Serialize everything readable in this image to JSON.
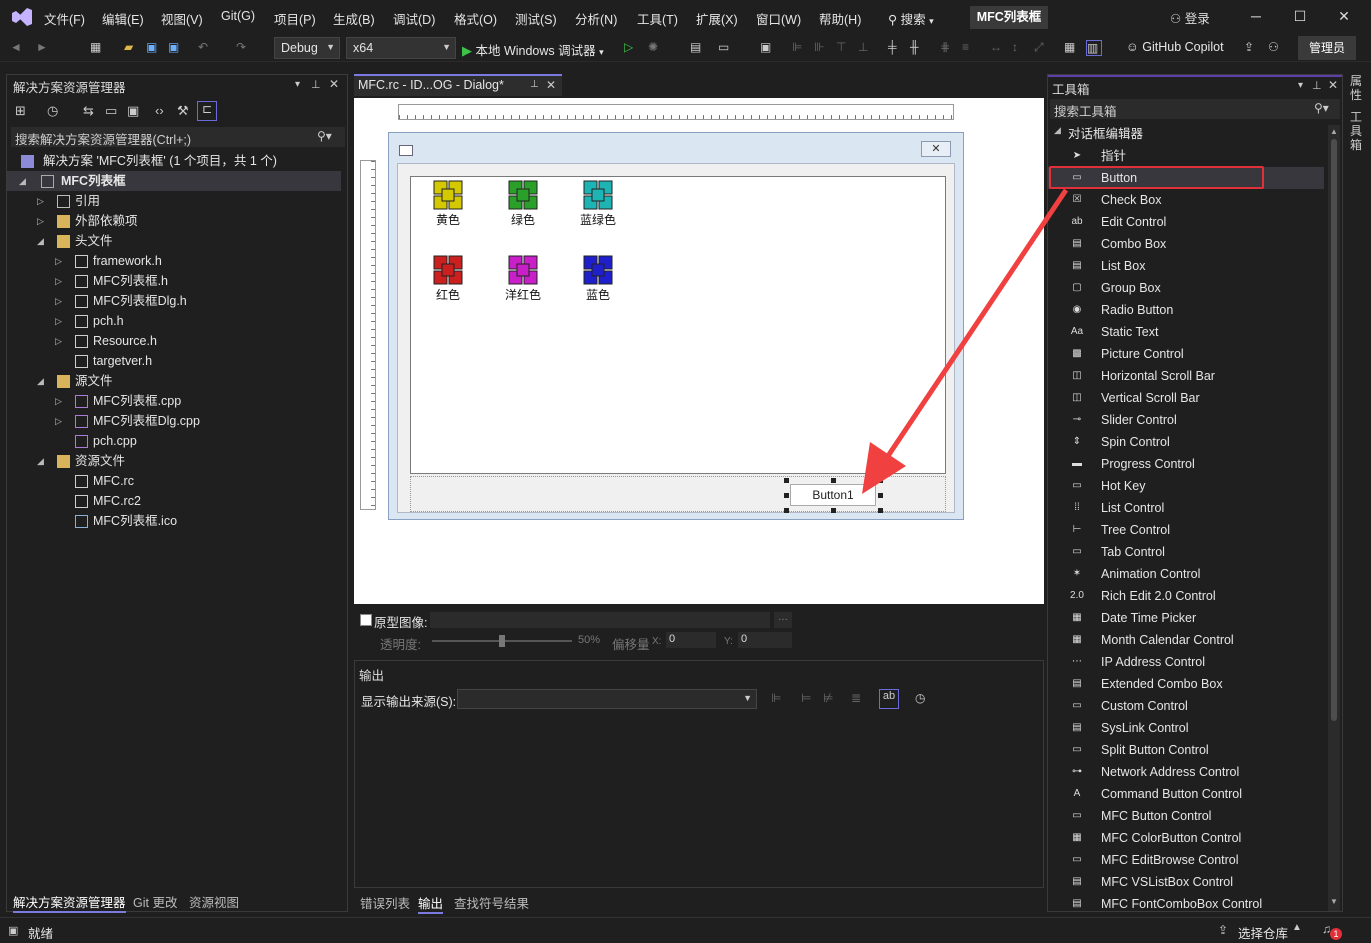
{
  "menubar": {
    "items": [
      "文件(F)",
      "编辑(E)",
      "视图(V)",
      "Git(G)",
      "项目(P)",
      "生成(B)",
      "调试(D)",
      "格式(O)",
      "测试(S)",
      "分析(N)",
      "工具(T)",
      "扩展(X)",
      "窗口(W)",
      "帮助(H)"
    ],
    "search_label": "搜索",
    "project_name": "MFC列表框",
    "login_label": "登录"
  },
  "toolbar": {
    "config": "Debug",
    "platform": "x64",
    "run_label": "本地 Windows 调试器",
    "copilot_label": "GitHub Copilot",
    "admin_label": "管理员"
  },
  "solution_explorer": {
    "title": "解决方案资源管理器",
    "search_placeholder": "搜索解决方案资源管理器(Ctrl+;)",
    "solution_label": "解决方案 'MFC列表框' (1 个项目，共 1 个)",
    "project": "MFC列表框",
    "nodes": [
      {
        "label": "引用",
        "kind": "ref"
      },
      {
        "label": "外部依赖项",
        "kind": "folder"
      },
      {
        "label": "头文件",
        "kind": "folder"
      },
      {
        "label": "framework.h",
        "kind": "h"
      },
      {
        "label": "MFC列表框.h",
        "kind": "h"
      },
      {
        "label": "MFC列表框Dlg.h",
        "kind": "h"
      },
      {
        "label": "pch.h",
        "kind": "h"
      },
      {
        "label": "Resource.h",
        "kind": "h"
      },
      {
        "label": "targetver.h",
        "kind": "h"
      },
      {
        "label": "源文件",
        "kind": "folder"
      },
      {
        "label": "MFC列表框.cpp",
        "kind": "cpp"
      },
      {
        "label": "MFC列表框Dlg.cpp",
        "kind": "cpp"
      },
      {
        "label": "pch.cpp",
        "kind": "cpp"
      },
      {
        "label": "资源文件",
        "kind": "folder"
      },
      {
        "label": "MFC.rc",
        "kind": "rc"
      },
      {
        "label": "MFC.rc2",
        "kind": "rc"
      },
      {
        "label": "MFC列表框.ico",
        "kind": "ico"
      }
    ],
    "bottom_tabs": [
      "解决方案资源管理器",
      "Git 更改",
      "资源视图"
    ]
  },
  "editor": {
    "tab_label": "MFC.rc - ID...OG - Dialog*",
    "list_items": [
      {
        "label": "黄色",
        "color": "#d4c800"
      },
      {
        "label": "绿色",
        "color": "#2aa02a"
      },
      {
        "label": "蓝绿色",
        "color": "#1fb4b4"
      },
      {
        "label": "红色",
        "color": "#cc1f1f"
      },
      {
        "label": "洋红色",
        "color": "#c81fc8"
      },
      {
        "label": "蓝色",
        "color": "#1f1fcc"
      }
    ],
    "button_label": "Button1",
    "proto_label": "原型图像:",
    "opacity_label": "透明度:",
    "opacity_value": "50%",
    "offset_label": "偏移量",
    "x_label": "X:",
    "x_value": "0",
    "y_label": "Y:",
    "y_value": "0",
    "opacity_fraction": 0.5
  },
  "output": {
    "title": "输出",
    "source_label": "显示输出来源(S):",
    "bottom_tabs": [
      "错误列表",
      "输出",
      "查找符号结果"
    ]
  },
  "toolbox": {
    "title": "工具箱",
    "search_placeholder": "搜索工具箱",
    "section": "对话框编辑器",
    "items": [
      "指针",
      "Button",
      "Check Box",
      "Edit Control",
      "Combo Box",
      "List Box",
      "Group Box",
      "Radio Button",
      "Static Text",
      "Picture Control",
      "Horizontal Scroll Bar",
      "Vertical Scroll Bar",
      "Slider Control",
      "Spin Control",
      "Progress Control",
      "Hot Key",
      "List Control",
      "Tree Control",
      "Tab Control",
      "Animation Control",
      "Rich Edit 2.0 Control",
      "Date Time Picker",
      "Month Calendar Control",
      "IP Address Control",
      "Extended Combo Box",
      "Custom Control",
      "SysLink Control",
      "Split Button Control",
      "Network Address Control",
      "Command Button Control",
      "MFC Button Control",
      "MFC ColorButton Control",
      "MFC EditBrowse Control",
      "MFC VSListBox Control",
      "MFC FontComboBox Control"
    ]
  },
  "side_tabs": [
    "属性",
    "工具箱"
  ],
  "status": {
    "ready": "就绪",
    "repo_label": "选择仓库",
    "notify_count": "1"
  },
  "colors": {
    "accent": "#5e3ea8",
    "highlight_red": "#e0303a",
    "arrow_red": "#f04040"
  }
}
